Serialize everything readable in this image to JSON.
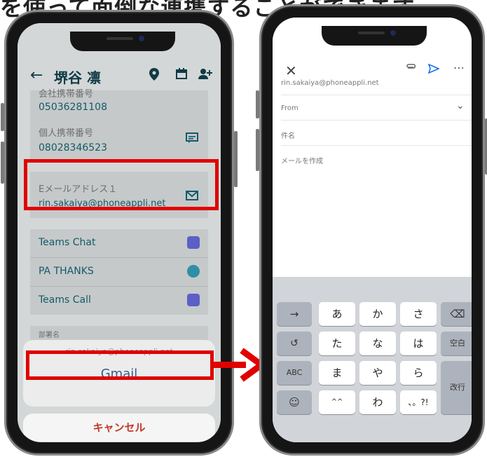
{
  "caption": "を使って面倒な連携することができます",
  "left": {
    "header": {
      "back": "←",
      "name": "堺谷 凛",
      "icons": [
        "map-pin-icon",
        "calendar-icon",
        "add-contact-icon"
      ]
    },
    "fields": [
      {
        "label": "会社携帯番号",
        "value": "05036281108"
      },
      {
        "label": "個人携帯番号",
        "value": "08028346523"
      }
    ],
    "email": {
      "label": "Eメールアドレス１",
      "value": "rin.sakaiya@phoneappli.net"
    },
    "apps": [
      {
        "label": "Teams Chat",
        "icon": "teams-icon"
      },
      {
        "label": "PA THANKS",
        "icon": "thanks-icon"
      },
      {
        "label": "Teams Call",
        "icon": "teams-icon"
      }
    ],
    "partial_label": "部署名",
    "sheet": {
      "subtitle": "rin.sakaiya@phoneappli.net",
      "gmail": "Gmail"
    },
    "cancel": "キャンセル"
  },
  "right": {
    "to": "rin.sakaiya@phoneappli.net",
    "from": "From",
    "subject": "件名",
    "body": "メールを作成",
    "keyboard": {
      "row1": [
        "→",
        "あ",
        "か",
        "さ",
        "⌫"
      ],
      "row2": [
        "↺",
        "た",
        "な",
        "は",
        "空白"
      ],
      "row3": [
        "ABC",
        "ま",
        "や",
        "ら",
        "改行"
      ],
      "row4": [
        "☺",
        "^^",
        "わ",
        "、。?!"
      ]
    }
  },
  "colors": {
    "highlight": "#e00000",
    "accent": "#125a6a"
  }
}
